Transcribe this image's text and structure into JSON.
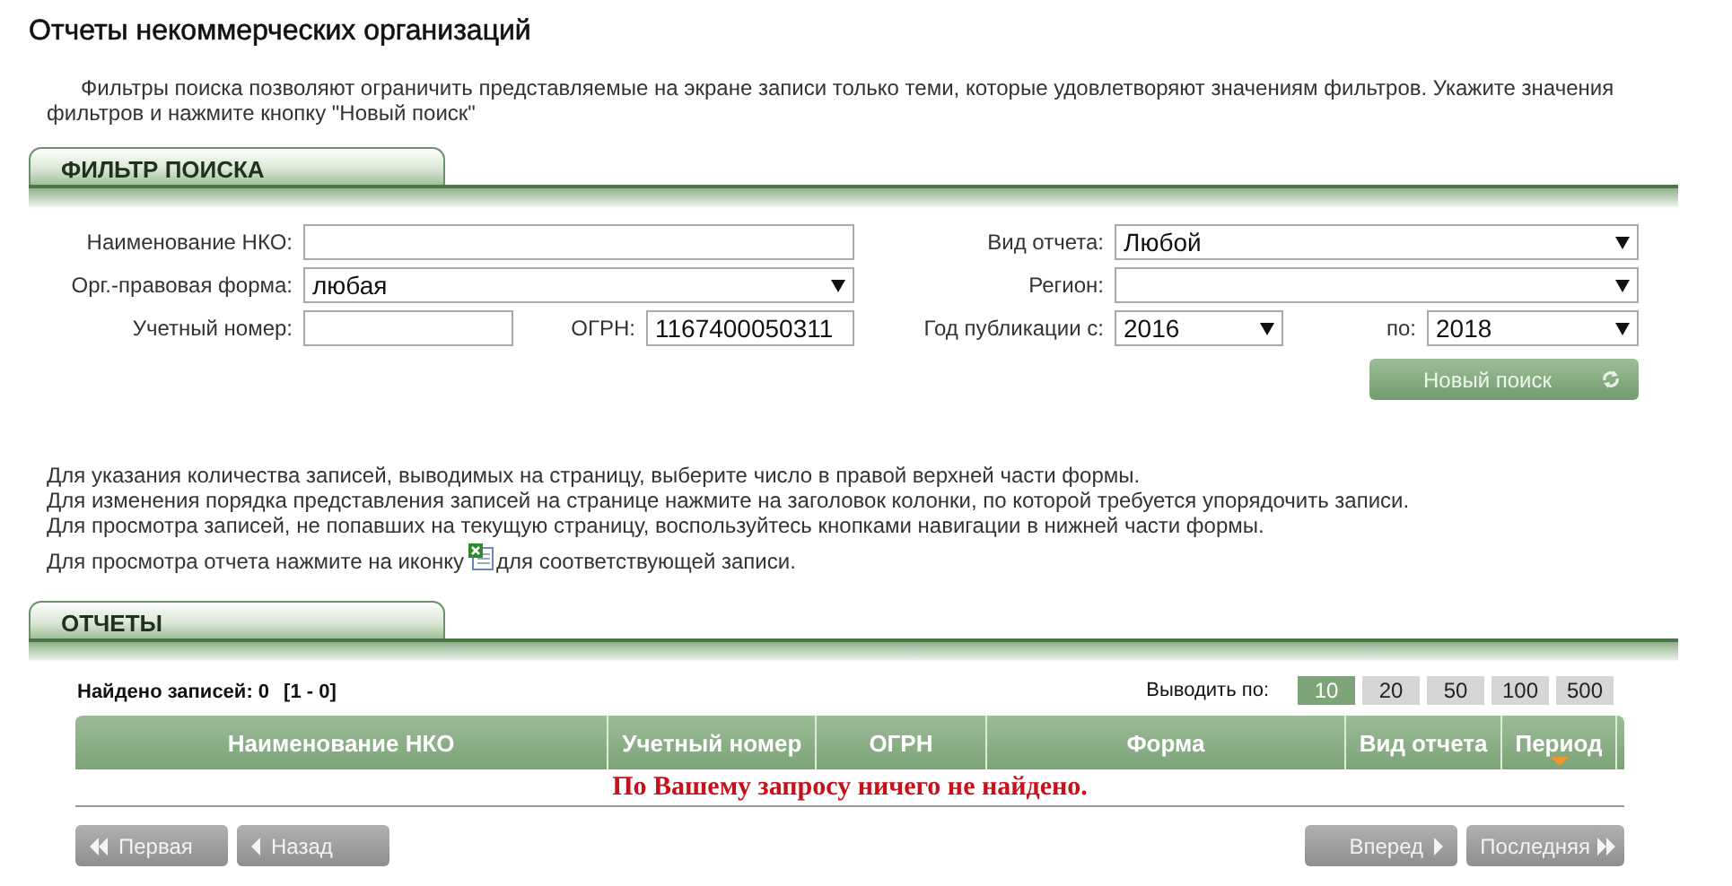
{
  "title": "Отчеты некоммерческих организаций",
  "intro": "Фильтры поиска позволяют ограничить представляемые на экране записи только теми, которые удовлетворяют значениям фильтров. Укажите значения фильтров и нажмите кнопку \"Новый поиск\"",
  "filter": {
    "heading": "ФИЛЬТР ПОИСКА",
    "left_rows": [
      [
        {
          "kind": "text",
          "label": "Наименование НКО:"
        }
      ],
      [
        {
          "kind": "select",
          "label": "Орг.-правовая форма:",
          "value": "любая"
        }
      ],
      [
        {
          "kind": "text",
          "label": "Учетный номер:"
        },
        {
          "kind": "text",
          "label": "ОГРН:",
          "value": "1167400050311"
        }
      ]
    ],
    "right_rows": [
      [
        {
          "kind": "select",
          "label": "Вид отчета:",
          "value": "Любой"
        }
      ],
      [
        {
          "kind": "select",
          "label": "Регион:"
        }
      ],
      [
        {
          "kind": "select",
          "label": "Год публикации с:",
          "value": "2016"
        },
        {
          "kind": "select",
          "label": "по:",
          "value": "2018"
        }
      ]
    ],
    "button": "Новый поиск"
  },
  "help": [
    "Для указания количества записей, выводимых на страницу, выберите число в правой верхней части формы.",
    "Для изменения порядка представления записей на странице нажмите на заголовок колонки, по которой требуется упорядочить записи.",
    "Для просмотра записей, не попавших на текущую страницу, воспользуйтесь кнопками навигации в нижней части формы."
  ],
  "icon_line": {
    "before": "Для просмотра отчета нажмите на иконку",
    "after": "для соответствующей записи."
  },
  "results": {
    "heading": "ОТЧЕТЫ",
    "found": "Найдено записей: 0",
    "range": "[1 - 0]",
    "page_size": {
      "label": "Выводить по:",
      "options": [
        {
          "label": "10",
          "selected": true
        },
        {
          "label": "20",
          "selected": false
        },
        {
          "label": "50",
          "selected": false
        },
        {
          "label": "100",
          "selected": false
        },
        {
          "label": "500",
          "selected": false
        }
      ]
    },
    "columns": [
      {
        "label": "Наименование НКО",
        "sorted": false
      },
      {
        "label": "Учетный номер",
        "sorted": false
      },
      {
        "label": "ОГРН",
        "sorted": false
      },
      {
        "label": "Форма",
        "sorted": false
      },
      {
        "label": "Вид отчета",
        "sorted": false
      },
      {
        "label": "Период",
        "sorted": true
      }
    ],
    "message": "По Вашему запросу ничего не найдено.",
    "nav": [
      {
        "kind": "first",
        "label": "Первая"
      },
      {
        "kind": "prev",
        "label": "Назад"
      },
      {
        "kind": "next",
        "label": "Вперед"
      },
      {
        "kind": "last",
        "label": "Последняя"
      }
    ]
  }
}
